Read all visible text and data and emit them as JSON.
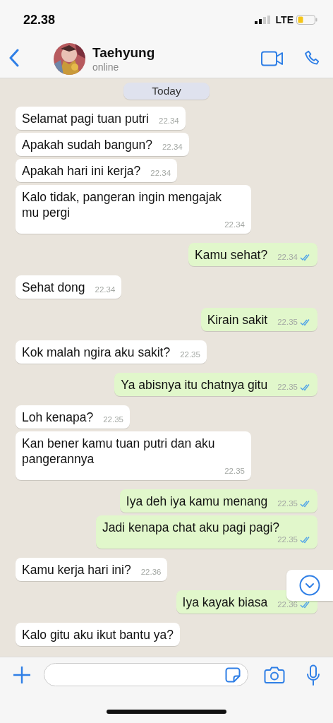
{
  "status_bar": {
    "time": "22.38",
    "network": "LTE"
  },
  "header": {
    "name": "Taehyung",
    "status": "online"
  },
  "date_divider": "Today",
  "messages": [
    {
      "kind": "incoming",
      "text": "Selamat pagi tuan putri",
      "time": "22.34"
    },
    {
      "kind": "incoming",
      "text": "Apakah sudah bangun?",
      "time": "22.34"
    },
    {
      "kind": "incoming",
      "text": "Apakah hari ini kerja?",
      "time": "22.34"
    },
    {
      "kind": "incoming",
      "text": "Kalo tidak, pangeran ingin mengajak mu pergi",
      "time": "22.34"
    },
    {
      "kind": "outgoing",
      "text": "Kamu sehat?",
      "time": "22.34",
      "read": true
    },
    {
      "kind": "incoming",
      "text": "Sehat dong",
      "time": "22.34"
    },
    {
      "kind": "outgoing",
      "text": "Kirain sakit",
      "time": "22.35",
      "read": true
    },
    {
      "kind": "incoming",
      "text": "Kok malah ngira aku sakit?",
      "time": "22.35"
    },
    {
      "kind": "outgoing",
      "text": "Ya abisnya itu chatnya gitu",
      "time": "22.35",
      "read": true
    },
    {
      "kind": "incoming",
      "text": "Loh kenapa?",
      "time": "22.35"
    },
    {
      "kind": "incoming",
      "text": "Kan bener kamu tuan putri dan aku pangerannya",
      "time": "22.35"
    },
    {
      "kind": "outgoing",
      "text": "Iya deh iya kamu menang",
      "time": "22.35",
      "read": true
    },
    {
      "kind": "outgoing",
      "text": "Jadi kenapa chat aku pagi pagi?",
      "time": "22.35",
      "read": true
    },
    {
      "kind": "incoming",
      "text": "Kamu kerja hari ini?",
      "time": "22.36"
    },
    {
      "kind": "outgoing",
      "text": "Iya kayak biasa",
      "time": "22.36",
      "read": true
    },
    {
      "kind": "incoming",
      "text": "Kalo gitu aku ikut bantu ya?"
    }
  ]
}
